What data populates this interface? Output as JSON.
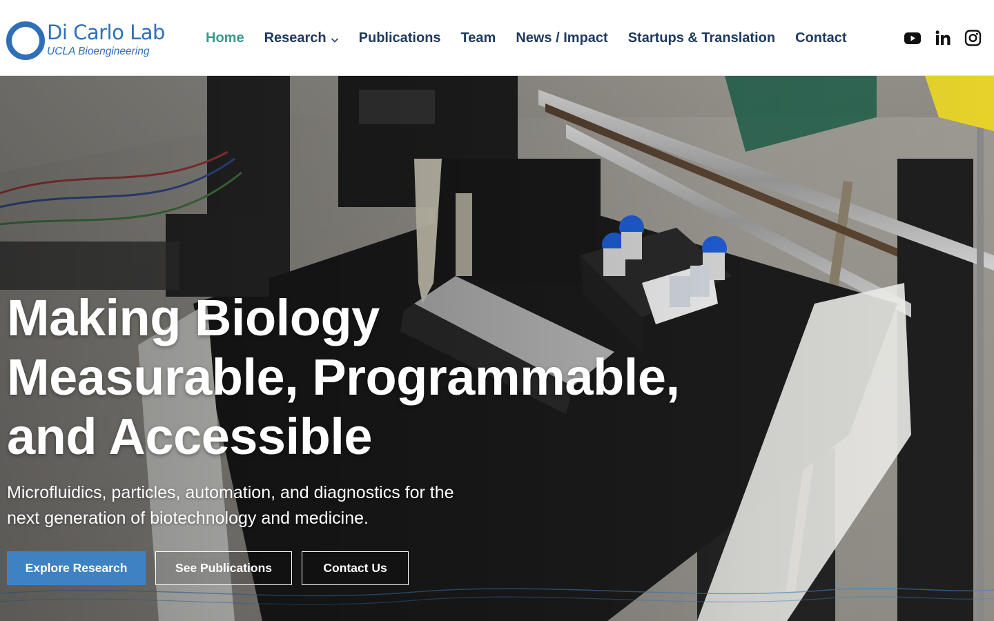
{
  "brand": {
    "title": "Di Carlo Lab",
    "subtitle": "UCLA Bioengineering",
    "color": "#2f6fb8"
  },
  "nav": {
    "items": [
      {
        "label": "Home",
        "active": true
      },
      {
        "label": "Research",
        "has_dropdown": true
      },
      {
        "label": "Publications"
      },
      {
        "label": "Team"
      },
      {
        "label": "News / Impact"
      },
      {
        "label": "Startups & Translation"
      },
      {
        "label": "Contact"
      }
    ],
    "active_color": "#3a9a8c",
    "text_color": "#1f3a60"
  },
  "social": [
    {
      "icon": "youtube-icon"
    },
    {
      "icon": "linkedin-icon"
    },
    {
      "icon": "instagram-icon"
    }
  ],
  "hero": {
    "headline": [
      "Making Biology",
      "Measurable, Programmable,",
      "and Accessible"
    ],
    "subtext": [
      "Microfluidics, particles, automation, and diagnostics for the",
      "next generation of biotechnology and medicine."
    ],
    "buttons": {
      "primary": "Explore Research",
      "publications": "See Publications",
      "contact": "Contact Us"
    },
    "button_color": "#3f82c4"
  }
}
